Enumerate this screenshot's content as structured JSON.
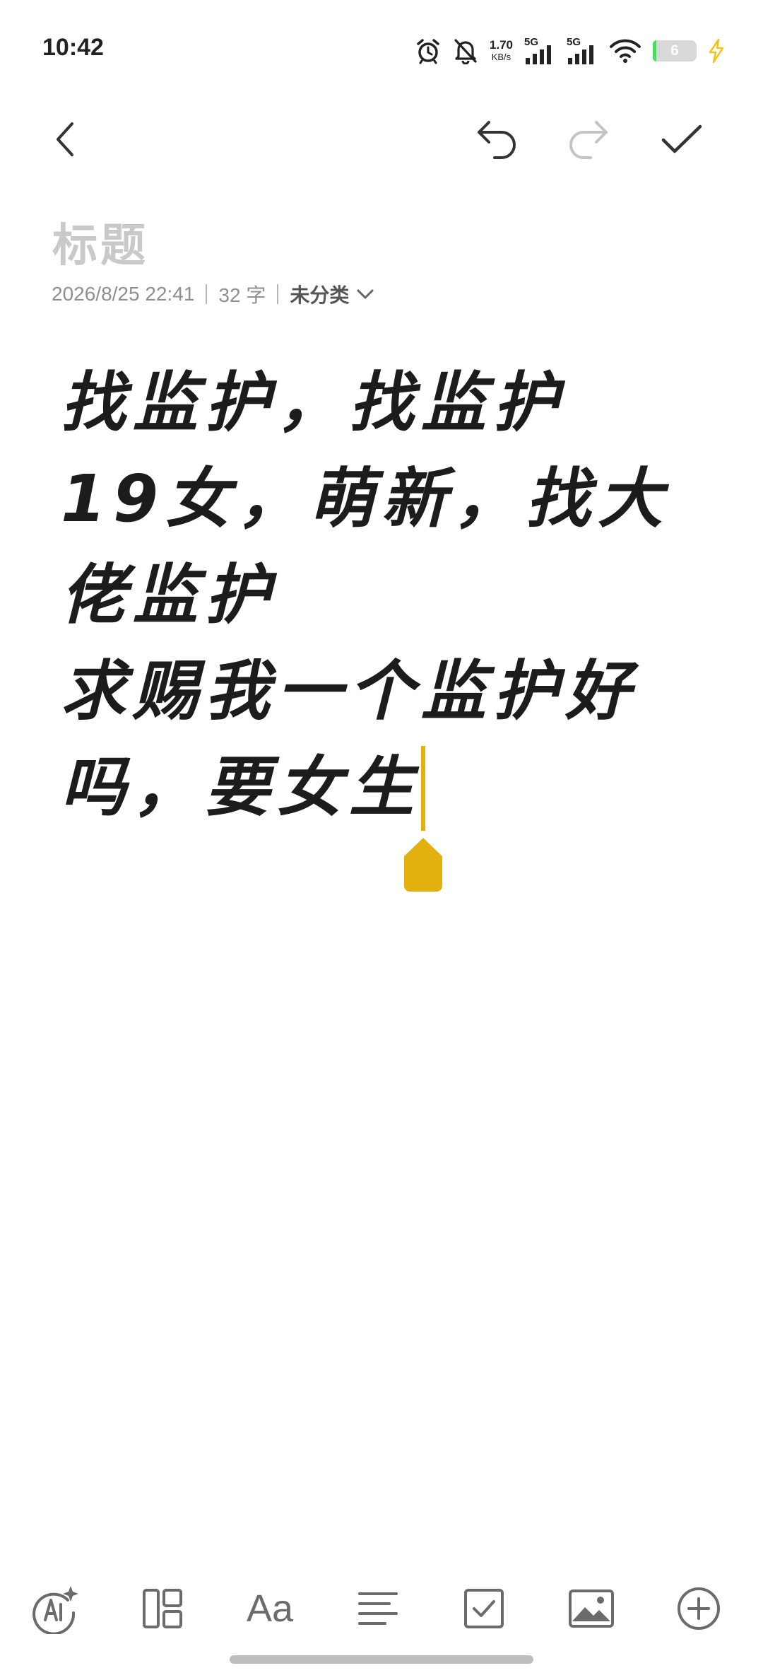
{
  "status_bar": {
    "time": "10:42",
    "net_speed_value": "1.70",
    "net_speed_unit": "KB/s",
    "sim1_label": "5G",
    "sim2_label": "5G",
    "battery_level": "6",
    "icons": [
      "alarm-icon",
      "bell-off-icon",
      "signal-icon",
      "wifi-icon",
      "battery-icon",
      "charging-icon"
    ]
  },
  "toolbar": {
    "icons": [
      "back-icon",
      "undo-icon",
      "redo-icon",
      "checkmark-icon"
    ]
  },
  "note": {
    "title_placeholder": "标题",
    "date": "2026/8/25 22:41",
    "word_count": "32 字",
    "category": "未分类",
    "lines": [
      "找监护，找监护",
      "19女，萌新，找大",
      "佬监护",
      "求赐我一个监护好",
      "吗，要女生"
    ]
  },
  "bottom_toolbar": {
    "items": [
      "ai-icon",
      "layout-icon",
      "text-format",
      "align-icon",
      "checkbox-icon",
      "image-icon",
      "add-icon"
    ],
    "text_format_label": "Aa"
  },
  "colors": {
    "accent": "#e2b10f",
    "text": "#1c1c1c",
    "placeholder": "#c9c9c9",
    "meta": "#8f8f8f",
    "icon": "#6b6b6b"
  }
}
